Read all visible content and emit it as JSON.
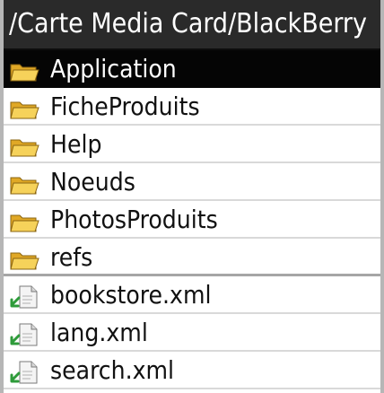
{
  "header": {
    "path": "/Carte Media Card/BlackBerry"
  },
  "folders": [
    {
      "label": "Application",
      "icon": "folder-icon",
      "selected": true
    },
    {
      "label": "FicheProduits",
      "icon": "folder-icon",
      "selected": false
    },
    {
      "label": "Help",
      "icon": "folder-icon",
      "selected": false
    },
    {
      "label": "Noeuds",
      "icon": "folder-icon",
      "selected": false
    },
    {
      "label": "PhotosProduits",
      "icon": "folder-icon",
      "selected": false
    },
    {
      "label": "refs",
      "icon": "folder-icon",
      "selected": false
    }
  ],
  "files": [
    {
      "label": "bookstore.xml",
      "icon": "file-shortcut-icon"
    },
    {
      "label": "lang.xml",
      "icon": "file-shortcut-icon"
    },
    {
      "label": "search.xml",
      "icon": "file-shortcut-icon"
    }
  ],
  "colors": {
    "header_bg": "#2a2a2a",
    "selection_bg": "#050505",
    "folder_yellow": "#e8b93a",
    "shortcut_green": "#2e9b3a"
  }
}
